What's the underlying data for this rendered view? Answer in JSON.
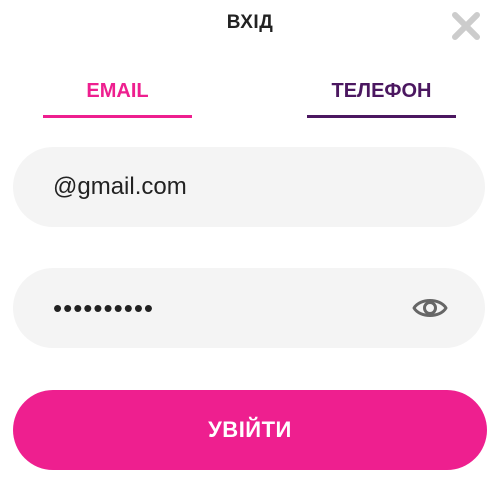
{
  "dialog": {
    "title": "ВХІД"
  },
  "tabs": [
    {
      "label": "EMAIL",
      "active": true
    },
    {
      "label": "ТЕЛЕФОН",
      "active": false
    }
  ],
  "email_field": {
    "value": "@gmail.com",
    "placeholder": ""
  },
  "password_field": {
    "value": "••••••••••",
    "placeholder": ""
  },
  "submit": {
    "label": "УВІЙТИ"
  },
  "icons": {
    "close": "close-icon",
    "eye": "eye-icon"
  },
  "colors": {
    "accent": "#ee1f8f",
    "secondary": "#4b1760",
    "field_bg": "#f4f4f4",
    "icon_gray": "#cccccc"
  }
}
